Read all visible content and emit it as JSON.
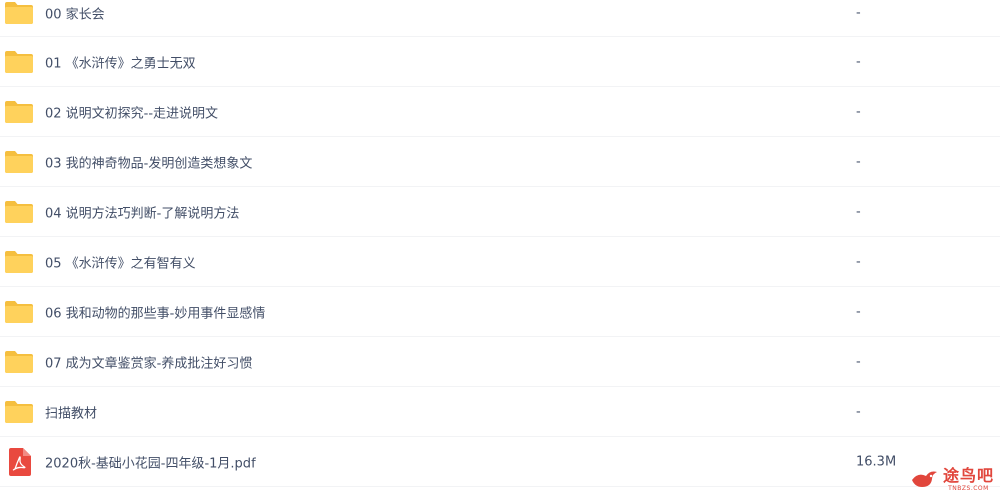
{
  "file_list": {
    "rows": [
      {
        "type": "folder",
        "icon": "folder-icon",
        "name": "00 家长会",
        "size": "-"
      },
      {
        "type": "folder",
        "icon": "folder-icon",
        "name": "01 《水浒传》之勇士无双",
        "size": "-"
      },
      {
        "type": "folder",
        "icon": "folder-icon",
        "name": "02 说明文初探究--走进说明文",
        "size": "-"
      },
      {
        "type": "folder",
        "icon": "folder-icon",
        "name": "03 我的神奇物品-发明创造类想象文",
        "size": "-"
      },
      {
        "type": "folder",
        "icon": "folder-icon",
        "name": "04 说明方法巧判断-了解说明方法",
        "size": "-"
      },
      {
        "type": "folder",
        "icon": "folder-icon",
        "name": "05 《水浒传》之有智有义",
        "size": "-"
      },
      {
        "type": "folder",
        "icon": "folder-icon",
        "name": "06 我和动物的那些事-妙用事件显感情",
        "size": "-"
      },
      {
        "type": "folder",
        "icon": "folder-icon",
        "name": "07 成为文章鉴赏家-养成批注好习惯",
        "size": "-"
      },
      {
        "type": "folder",
        "icon": "folder-icon",
        "name": "扫描教材",
        "size": "-"
      },
      {
        "type": "pdf",
        "icon": "pdf-file-icon",
        "name": "2020秋-基础小花园-四年级-1月.pdf",
        "size": "16.3M"
      }
    ]
  },
  "watermark": {
    "main": "途鸟吧",
    "sub": "TNBZS.COM"
  },
  "colors": {
    "folder": "#ffd25c",
    "folder_tab": "#f5bf3f",
    "pdf": "#e9493f",
    "text": "#424e67",
    "watermark": "#e1463c"
  }
}
